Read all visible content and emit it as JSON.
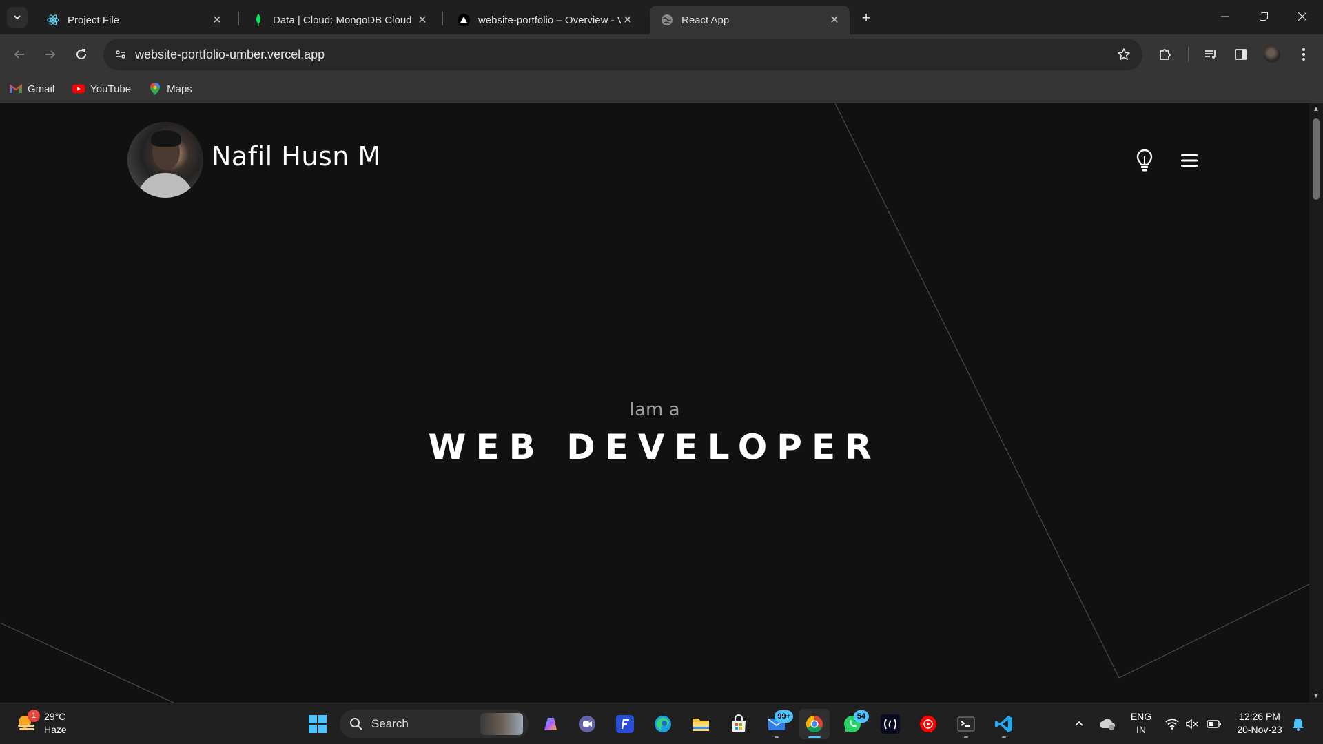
{
  "browser": {
    "tabs": [
      {
        "title": "Project File",
        "icon": "react-icon"
      },
      {
        "title": "Data | Cloud: MongoDB Cloud",
        "icon": "mongodb-leaf-icon"
      },
      {
        "title": "website-portfolio – Overview - V",
        "icon": "vercel-triangle-icon"
      },
      {
        "title": "React App",
        "icon": "globe-icon",
        "active": true
      }
    ],
    "url": "website-portfolio-umber.vercel.app",
    "bookmarks": [
      {
        "label": "Gmail",
        "icon": "gmail-icon"
      },
      {
        "label": "YouTube",
        "icon": "youtube-icon"
      },
      {
        "label": "Maps",
        "icon": "maps-pin-icon"
      }
    ]
  },
  "page": {
    "site_name": "Nafil Husn M",
    "hero_subtitle": "Iam a",
    "hero_title": "WEB DEVELOPER"
  },
  "taskbar": {
    "weather": {
      "temp": "29°C",
      "condition": "Haze",
      "badge": "1"
    },
    "search_label": "Search",
    "badges": {
      "mail": "99+",
      "whatsapp": "54"
    },
    "language": {
      "line1": "ENG",
      "line2": "IN"
    },
    "clock": {
      "time": "12:26 PM",
      "date": "20-Nov-23"
    }
  },
  "colors": {
    "page_bg": "#111111",
    "chrome_frame": "#1f1f1f",
    "chrome_toolbar": "#353535",
    "taskbar": "#202020",
    "accent_blue": "#4cc2ff"
  }
}
